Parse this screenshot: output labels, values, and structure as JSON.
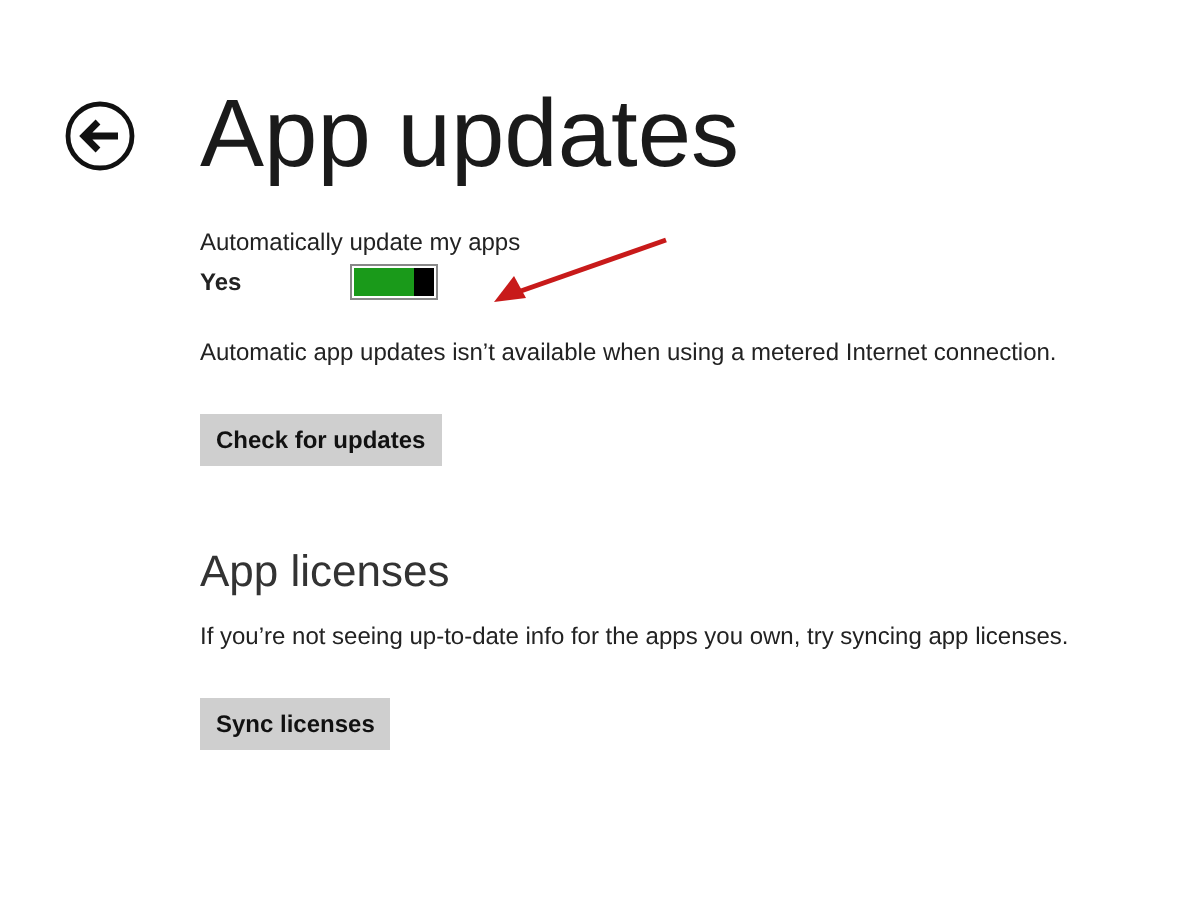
{
  "title": "App updates",
  "auto_update": {
    "label": "Automatically update my apps",
    "value": "Yes",
    "on": true
  },
  "auto_update_note": "Automatic app updates isn’t available when using a metered Internet connection.",
  "check_button": "Check for updates",
  "licenses": {
    "heading": "App licenses",
    "note": "If you’re not seeing up-to-date info for the apps you own, try syncing app licenses.",
    "button": "Sync licenses"
  }
}
